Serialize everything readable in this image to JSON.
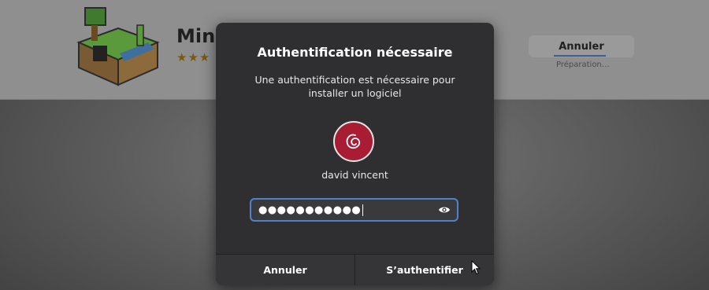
{
  "background_app": {
    "title": "Mine",
    "stars": "★★★",
    "cancel_label": "Annuler",
    "status": "Préparation…"
  },
  "dialog": {
    "title": "Authentification nécessaire",
    "description": "Une authentification est nécessaire pour installer un logiciel",
    "username": "david vincent",
    "password_masked": "●●●●●●●●●●●",
    "cancel_label": "Annuler",
    "authenticate_label": "S’authentifier"
  },
  "icons": {
    "avatar": "debian-swirl-icon",
    "reveal": "eye-icon",
    "app": "minetest-icon"
  },
  "colors": {
    "dialog_bg": "#2f2f31",
    "avatar_bg": "#a81d33",
    "focus_ring": "#4f83c9"
  }
}
